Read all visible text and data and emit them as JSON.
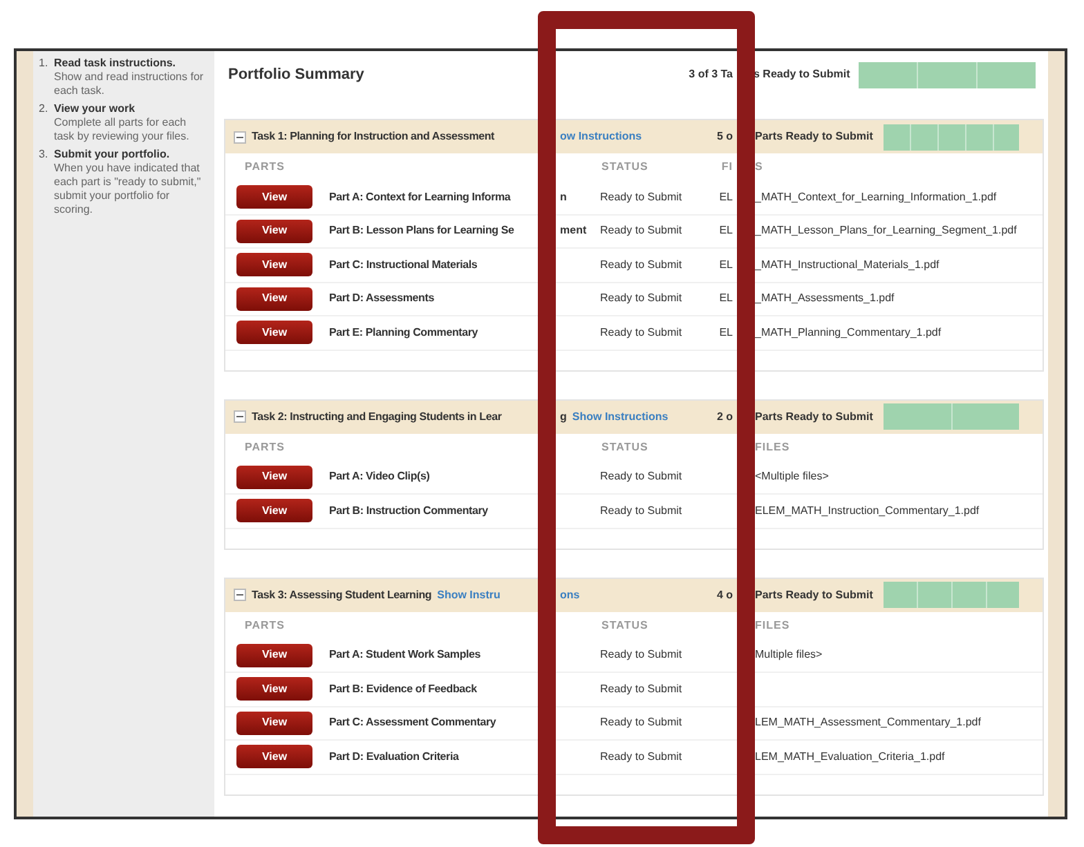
{
  "sidebar": {
    "steps": [
      {
        "number": "1.",
        "title": "Read task instructions.",
        "text": "Show and read instructions for each task."
      },
      {
        "number": "2.",
        "title": "View your work",
        "text": "Complete all parts for each task by reviewing your files."
      },
      {
        "number": "3.",
        "title": "Submit your portfolio.",
        "text": "When you have indicated that each part is \"ready to submit,\" submit your portfolio for scoring."
      }
    ]
  },
  "summary": {
    "title": "Portfolio Summary",
    "status_start": "3 of 3 Ta",
    "status_end": "s Ready to Submit",
    "progress": {
      "level": 1
    }
  },
  "tasks": [
    {
      "expanded": true,
      "title": "Task 1: Planning for Instruction and Assessment",
      "link_end": "ow Instructions",
      "count_start": "5 o",
      "count_end": "Parts Ready to Submit",
      "progress": {
        "level": 1
      },
      "columns": {
        "parts": "PARTS",
        "status": "STATUS",
        "files_start": "FI",
        "files_end": "S"
      },
      "rows": [
        {
          "button": "View",
          "name": "Part A: Context for Learning Informa",
          "name_tail": "n",
          "status": "Ready to Submit",
          "file_start": "EL",
          "file_end": "_MATH_Context_for_Learning_Information_1.pdf"
        },
        {
          "button": "View",
          "name": "Part B: Lesson Plans for Learning Se",
          "name_tail": "ment",
          "status": "Ready to Submit",
          "file_start": "EL",
          "file_end": "_MATH_Lesson_Plans_for_Learning_Segment_1.pdf"
        },
        {
          "button": "View",
          "name": "Part C: Instructional Materials",
          "status": "Ready to Submit",
          "file_start": "EL",
          "file_end": "_MATH_Instructional_Materials_1.pdf"
        },
        {
          "button": "View",
          "name": "Part D: Assessments",
          "status": "Ready to Submit",
          "file_start": "EL",
          "file_end": "_MATH_Assessments_1.pdf"
        },
        {
          "button": "View",
          "name": "Part E: Planning Commentary",
          "status": "Ready to Submit",
          "file_start": "EL",
          "file_end": "_MATH_Planning_Commentary_1.pdf"
        }
      ]
    },
    {
      "expanded": true,
      "title": "Task 2: Instructing and Engaging Students in Lear",
      "title_tail": "g",
      "link_end": "Show Instructions",
      "count_start": "2 o",
      "count_end": "Parts Ready to Submit",
      "progress": {
        "level": 1
      },
      "columns": {
        "parts": "PARTS",
        "status": "STATUS",
        "files_end": "FILES"
      },
      "rows": [
        {
          "button": "View",
          "name": "Part A: Video Clip(s)",
          "status": "Ready to Submit",
          "file_end": "<Multiple files>"
        },
        {
          "button": "View",
          "name": "Part B: Instruction Commentary",
          "status": "Ready to Submit",
          "file_end": "ELEM_MATH_Instruction_Commentary_1.pdf"
        }
      ]
    },
    {
      "expanded": true,
      "title": "Task 3: Assessing Student Learning",
      "link_start": "Show Instru",
      "link_end": "ons",
      "count_start": "4 o",
      "count_end": "Parts Ready to Submit",
      "progress": {
        "level": 1
      },
      "columns": {
        "parts": "PARTS",
        "status": "STATUS",
        "files_end": "FILES"
      },
      "rows": [
        {
          "button": "View",
          "name": "Part A: Student Work Samples",
          "status": "Ready to Submit",
          "file_end": "Multiple files>"
        },
        {
          "button": "View",
          "name": "Part B: Evidence of Feedback",
          "status": "Ready to Submit"
        },
        {
          "button": "View",
          "name": "Part C: Assessment Commentary",
          "status": "Ready to Submit",
          "file_end": "LEM_MATH_Assessment_Commentary_1.pdf"
        },
        {
          "button": "View",
          "name": "Part D: Evaluation Criteria",
          "status": "Ready to Submit",
          "file_end": "LEM_MATH_Evaluation_Criteria_1.pdf"
        }
      ]
    }
  ]
}
